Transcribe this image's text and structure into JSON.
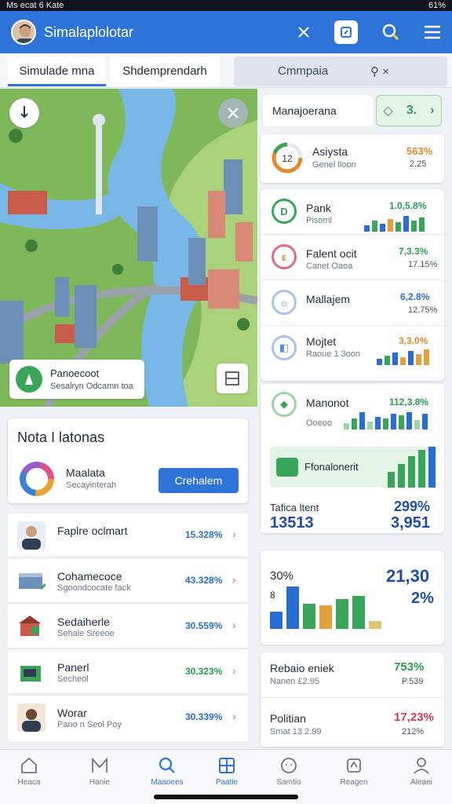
{
  "status": {
    "left": "Ms ecat 6 Kate",
    "right": "61%"
  },
  "app": {
    "title": "Simalaplolotar"
  },
  "tabs": [
    {
      "label": "Simulade mna"
    },
    {
      "label": "Shdemprendarh"
    },
    {
      "label": "Cmmpaia"
    }
  ],
  "map": {
    "info_title": "Panoecoot",
    "info_sub": "Sesalryn Odcamn toa"
  },
  "nota": {
    "title": "Nota I latonas",
    "item_title": "Maalata",
    "item_sub": "Secayinterah",
    "button": "Crehalem"
  },
  "list": [
    {
      "title": "Faplre oclmart",
      "sub": "",
      "value": "15.328%",
      "value_color": "#2b6ed3"
    },
    {
      "title": "Cohamecoce",
      "sub": "Sgoondcocate fack",
      "value": "43.328%",
      "value_color": "#2b6ed3"
    },
    {
      "title": "Sedaiherle",
      "sub": "Sehale Sreeoe",
      "value": "30.559%",
      "value_color": "#2b6ed3"
    },
    {
      "title": "Panerl",
      "sub": "Secheol",
      "value": "30.323%",
      "value_color": "#2e9c52"
    },
    {
      "title": "Worar",
      "sub": "Pano n Seol Poy",
      "value": "30.339%",
      "value_color": "#2b6ed3"
    }
  ],
  "right": {
    "header_title": "Manajoerana",
    "header_badge": "3.",
    "rows": [
      {
        "title": "Asiysta",
        "sub": "Genel lloon",
        "value": "563%",
        "sub_value": "2.25",
        "value_color": "#e08a2c",
        "ring_color": "#e38a2d",
        "ring_label": "12"
      },
      {
        "title": "Pank",
        "sub": "Pisoml",
        "value": "1.0,5.8%",
        "sub_value": "",
        "value_color": "#2e9c52",
        "ring_color": "#38a55a",
        "ring_label": "D"
      },
      {
        "title": "Falent ocit",
        "sub": "Canet Oaoa",
        "value": "7,3.3%",
        "sub_value": "17.15%",
        "value_color": "#2e9c52",
        "ring_color": "#e26b86",
        "ring_label": "ε"
      },
      {
        "title": "Mallajem",
        "sub": "",
        "value": "6,2.8%",
        "sub_value": "12.75%",
        "value_color": "#2b6ed3",
        "ring_color": "#5a8fd6",
        "ring_label": "☼"
      },
      {
        "title": "Mojtet",
        "sub": "Raoue 1 3oon",
        "value": "3,3.0%",
        "sub_value": "",
        "value_color": "#e08a2c",
        "ring_color": "#5a8fd6",
        "ring_label": "◧"
      },
      {
        "title": "Manonot",
        "sub": "Ooeoo",
        "value": "112,3.8%",
        "sub_value": "",
        "value_color": "#2e9c52",
        "ring_color": "#38a55a",
        "ring_label": "◆"
      }
    ],
    "highlight": "Ffonalonerit",
    "stats": {
      "label": "Tafica ltent",
      "left_value": "13513",
      "right_pct": "299%",
      "right_value": "3,951"
    },
    "chart": {
      "left_pct": "30%",
      "left_small": "8",
      "right_value": "21,30",
      "right_pct": "2%"
    },
    "bottom": [
      {
        "title": "Rebaio eniek",
        "sub": "Nanen £2.95",
        "value": "753%",
        "sub_value": "P.539",
        "value_color": "#2e9c52"
      },
      {
        "title": "Politian",
        "sub": "Smat 13 2.99",
        "value": "17,23%",
        "sub_value": "212%",
        "value_color": "#d23a5e"
      }
    ]
  },
  "nav": [
    {
      "label": "Heaca",
      "icon": "home-icon"
    },
    {
      "label": "Hanie",
      "icon": "chart-icon"
    },
    {
      "label": "Maaoees",
      "icon": "search-icon"
    },
    {
      "label": "Paatie",
      "icon": "board-icon"
    },
    {
      "label": "Samtio",
      "icon": "face-icon"
    },
    {
      "label": "Reagen",
      "icon": "tag-icon"
    },
    {
      "label": "Aleaei",
      "icon": "person-icon"
    }
  ]
}
